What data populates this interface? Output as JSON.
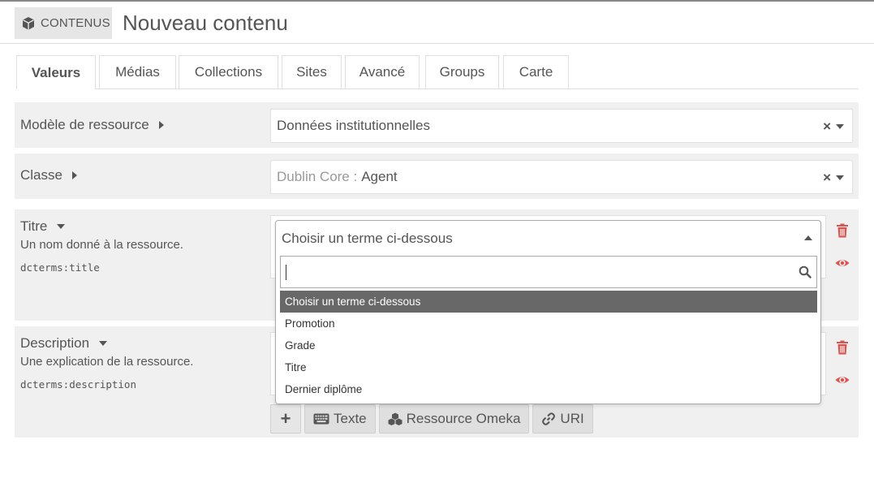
{
  "header": {
    "section_label": "CONTENUS",
    "page_title": "Nouveau contenu"
  },
  "tabs": [
    {
      "label": "Valeurs"
    },
    {
      "label": "Médias"
    },
    {
      "label": "Collections"
    },
    {
      "label": "Sites"
    },
    {
      "label": "Avancé"
    },
    {
      "label": "Groups"
    },
    {
      "label": "Carte"
    }
  ],
  "resource_template": {
    "label": "Modèle de ressource",
    "value": "Données institutionnelles",
    "clear": "×"
  },
  "resource_class": {
    "label": "Classe",
    "vocab": "Dublin Core :",
    "value": "Agent",
    "clear": "×"
  },
  "fields": [
    {
      "label": "Titre",
      "description": "Un nom donné à la ressource.",
      "term": "dcterms:title"
    },
    {
      "label": "Description",
      "description": "Une explication de la ressource.",
      "term": "dcterms:description"
    }
  ],
  "add_value_buttons": {
    "plus": "+",
    "text": "Texte",
    "resource": "Ressource Omeka",
    "uri": "URI"
  },
  "dropdown": {
    "selected": "Choisir un terme ci-dessous",
    "search_value": "",
    "options": [
      "Choisir un terme ci-dessous",
      "Promotion",
      "Grade",
      "Titre",
      "Dernier diplôme"
    ]
  },
  "colors": {
    "accent_red": "#d9534f",
    "row_bg": "#f0f0f0",
    "selected_option": "#686868"
  }
}
